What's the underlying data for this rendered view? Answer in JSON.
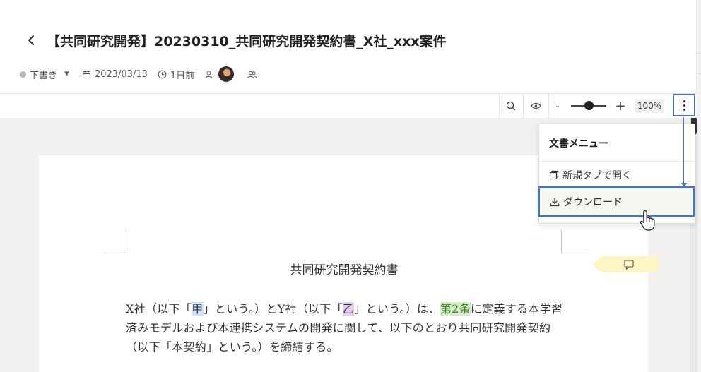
{
  "header": {
    "title": "【共同研究開発】20230310_共同研究開発契約書_X社_xxx案件"
  },
  "meta": {
    "status": "下書き",
    "date": "2023/03/13",
    "relative_time": "1日前"
  },
  "toolbar": {
    "zoom_minus": "-",
    "zoom_plus": "+",
    "zoom_level": "100%",
    "zoom_fraction": 0.5
  },
  "menu": {
    "heading": "文書メニュー",
    "items": [
      {
        "label": "新規タブで開く",
        "icon": "open-in-new-tab-icon"
      },
      {
        "label": "ダウンロード",
        "icon": "download-icon"
      }
    ]
  },
  "document": {
    "title": "共同研究開発契約書",
    "p1": "X社（以下「",
    "p1_party_a": "甲",
    "p1_mid": "」という。）とY社（以下「",
    "p1_party_b": "乙",
    "p1_mid2": "」という。）は、",
    "p1_clause": "第2条",
    "p1_tail": "に定義する本学習済みモデルおよび本連携システムの開発に関して、以下のとおり共同研究開発契約（以下「本契約」という。）を締結する。"
  },
  "colors": {
    "accent_outline": "#4a74b8",
    "highlight_blue": "#cfe4fb",
    "highlight_purple": "#e3cdf3",
    "highlight_green": "#d4efc8",
    "comment_tag": "#fdf5c4"
  }
}
